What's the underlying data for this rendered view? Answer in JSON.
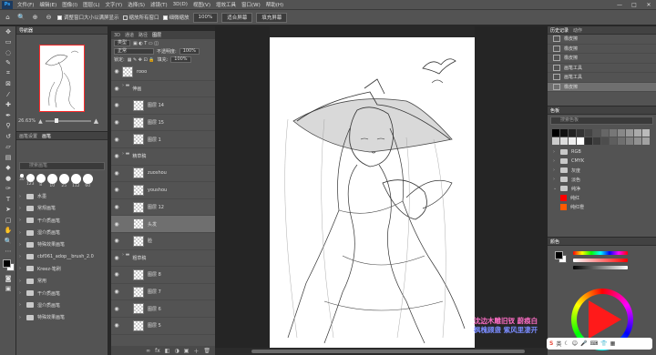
{
  "app_logo": "Ps",
  "menu": [
    "文件(F)",
    "编辑(E)",
    "图像(I)",
    "图层(L)",
    "文字(Y)",
    "选择(S)",
    "滤镜(T)",
    "3D(D)",
    "视图(V)",
    "增效工具",
    "窗口(W)",
    "帮助(H)"
  ],
  "window_controls": [
    "—",
    "□",
    "✕"
  ],
  "options": {
    "resize_windows": "调整窗口大小以满屏显示",
    "zoom_all": "缩放所有窗口",
    "scrubby_zoom": "细微缩放",
    "zoom_pct": "100%",
    "fit_screen": "适合屏幕",
    "fill_screen": "填充屏幕"
  },
  "navigator": {
    "tab": "导航器",
    "zoom": "26.63%"
  },
  "brush_panel": {
    "tabs": [
      "画笔设置",
      "画笔"
    ],
    "search_placeholder": "搜索画笔",
    "sizes": [
      "30",
      "123",
      "8",
      "10",
      "25",
      "112",
      "60",
      "50",
      "25",
      "30",
      "50",
      "60",
      "100"
    ],
    "folders": [
      "常规画笔",
      "干介质画笔",
      "湿介质画笔",
      "特殊效果画笔",
      "cbf061_adop__brush_2.0",
      "Kreez-笔刷",
      "常用",
      "干介质画笔",
      "湿介质画笔",
      "特殊效果画笔"
    ],
    "folder_partial": "水墨"
  },
  "layers_panel": {
    "tabs": [
      "3D",
      "通道",
      "路径",
      "图层"
    ],
    "filter_label": "类型",
    "blend_mode": "正常",
    "opacity_label": "不透明度:",
    "opacity": "100%",
    "lock_label": "锁定:",
    "fill_label": "填充:",
    "fill": "100%",
    "layers": [
      {
        "name": "rooo",
        "type": "layer",
        "indent": 0,
        "active": false
      },
      {
        "name": "伸画",
        "type": "group",
        "indent": 0,
        "active": false
      },
      {
        "name": "图层 14",
        "type": "layer",
        "indent": 1,
        "active": false
      },
      {
        "name": "图层 15",
        "type": "layer",
        "indent": 1,
        "active": false
      },
      {
        "name": "图层 1",
        "type": "layer",
        "indent": 1,
        "active": false
      },
      {
        "name": "精草稿",
        "type": "group",
        "indent": 0,
        "active": false
      },
      {
        "name": "zuoshou",
        "type": "layer",
        "indent": 1,
        "active": false
      },
      {
        "name": "youshou",
        "type": "layer",
        "indent": 1,
        "active": false
      },
      {
        "name": "图层 12",
        "type": "layer",
        "indent": 1,
        "active": false
      },
      {
        "name": "头发",
        "type": "layer",
        "indent": 1,
        "active": true
      },
      {
        "name": "脸",
        "type": "layer",
        "indent": 1,
        "active": false
      },
      {
        "name": "粗草稿",
        "type": "group",
        "indent": 0,
        "active": false
      },
      {
        "name": "图层 8",
        "type": "layer",
        "indent": 1,
        "active": false
      },
      {
        "name": "图层 7",
        "type": "layer",
        "indent": 1,
        "active": false
      },
      {
        "name": "图层 6",
        "type": "layer",
        "indent": 1,
        "active": false
      },
      {
        "name": "图层 5",
        "type": "layer",
        "indent": 1,
        "active": false
      }
    ],
    "footer_icons": [
      "∞",
      "fx",
      "◧",
      "◑",
      "▣",
      "＋",
      "🗑"
    ]
  },
  "history_panel": {
    "tabs": [
      "历史记录",
      "动作"
    ],
    "items": [
      "橡皮擦",
      "橡皮擦",
      "橡皮擦",
      "画笔工具",
      "画笔工具",
      "橡皮擦"
    ]
  },
  "swatch_panel": {
    "tab": "色板",
    "search_placeholder": "搜索色板",
    "grid_colors": [
      "#000000",
      "#111111",
      "#222222",
      "#333333",
      "#444444",
      "#555555",
      "#666666",
      "#777777",
      "#888888",
      "#999999",
      "#aaaaaa",
      "#bbbbbb",
      "#cccccc",
      "#dddddd",
      "#eeeeee",
      "#ffffff",
      "#2b2b2b",
      "#3c3c3c",
      "#4d4d4d",
      "#5e5e5e",
      "#6f6f6f",
      "#808080",
      "#919191",
      "#a2a2a2"
    ],
    "groups": [
      "RGB",
      "CMYK",
      "灰度",
      "淡色",
      "纯净"
    ],
    "pure": [
      {
        "name": "纯红",
        "color": "#ff0000"
      },
      {
        "name": "纯红橙",
        "color": "#ff5a00"
      }
    ]
  },
  "color_panel": {
    "tab": "颜色",
    "fg": "#000000",
    "bg": "#ffffff"
  },
  "watermark": {
    "line1": "沈边木雕旧钗 蔚痕白",
    "line2": "枫槐顾盏 紫风里凄开",
    "color1": "#ff6ec7",
    "color2": "#7a8cff"
  },
  "ime": {
    "label": "英"
  }
}
